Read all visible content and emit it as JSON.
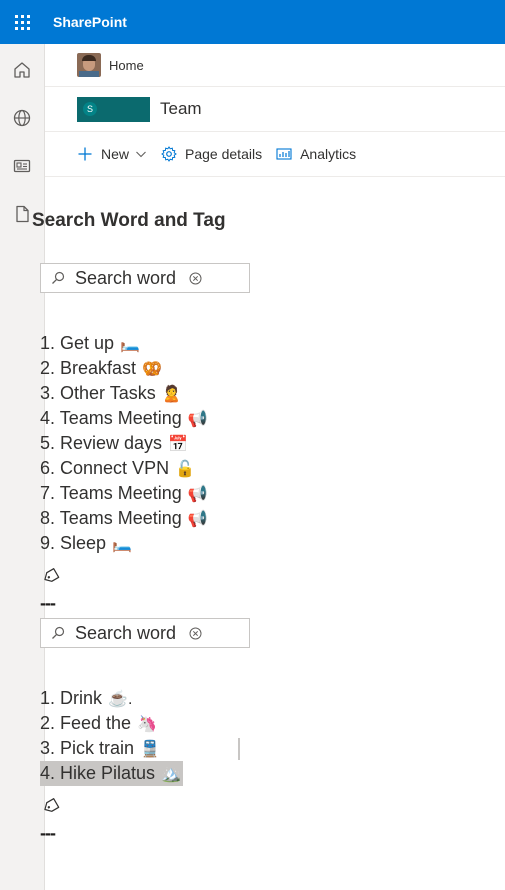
{
  "app": {
    "name": "SharePoint"
  },
  "rail": {
    "items": [
      "home-icon",
      "globe-icon",
      "news-icon",
      "document-icon"
    ]
  },
  "breadcrumb": {
    "label": "Home"
  },
  "site": {
    "title": "Team",
    "logo_letter": "S"
  },
  "commands": {
    "new_label": "New",
    "page_details_label": "Page details",
    "analytics_label": "Analytics"
  },
  "content": {
    "heading": "Search Word and Tag"
  },
  "search1": {
    "placeholder": "Search word"
  },
  "list1": [
    {
      "text": "1. Get up",
      "emoji": "🛏️"
    },
    {
      "text": "2. Breakfast",
      "emoji": "🥨"
    },
    {
      "text": "3. Other Tasks",
      "emoji": "🙎"
    },
    {
      "text": "4. Teams Meeting",
      "emoji": "📢"
    },
    {
      "text": "5. Review days",
      "emoji": "📅"
    },
    {
      "text": "6. Connect VPN",
      "emoji": "🔓"
    },
    {
      "text": "7. Teams Meeting",
      "emoji": "📢"
    },
    {
      "text": "8. Teams Meeting",
      "emoji": "📢"
    },
    {
      "text": "9. Sleep",
      "emoji": "🛏️"
    }
  ],
  "separator": "---",
  "search2": {
    "placeholder": "Search word"
  },
  "list2": [
    {
      "text": "1. Drink",
      "emoji": "☕."
    },
    {
      "text": "2. Feed the",
      "emoji": "🦄"
    },
    {
      "text": "3. Pick train",
      "emoji": "🚆"
    },
    {
      "text": "4. Hike Pilatus",
      "emoji": "🏔️"
    }
  ],
  "colors": {
    "brand": "#0078d4",
    "rail": "#f3f2f1",
    "accent": "#0078d4",
    "highlight": "#c8c6c4"
  }
}
